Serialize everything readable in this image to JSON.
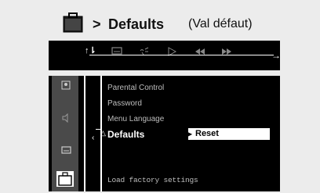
{
  "header": {
    "arrow": ">",
    "title": "Defaults",
    "subtitle": "(Val défaut)"
  },
  "top_bar": {
    "icons": [
      "setup-icon",
      "subtitle-icon",
      "audio-icon",
      "play-icon",
      "rewind-icon",
      "fast-forward-icon"
    ]
  },
  "menu": {
    "items": [
      {
        "label": "Parental Control"
      },
      {
        "label": "Password"
      },
      {
        "label": "Menu Language"
      },
      {
        "label": "Defaults"
      }
    ],
    "selected_value": "Reset",
    "footer": "Load factory settings"
  },
  "colors": {
    "background": "#ececec",
    "panel": "#000000",
    "sidebar": "#4a4a4a",
    "text_dim": "#bdbdbd",
    "text_active": "#ffffff"
  }
}
